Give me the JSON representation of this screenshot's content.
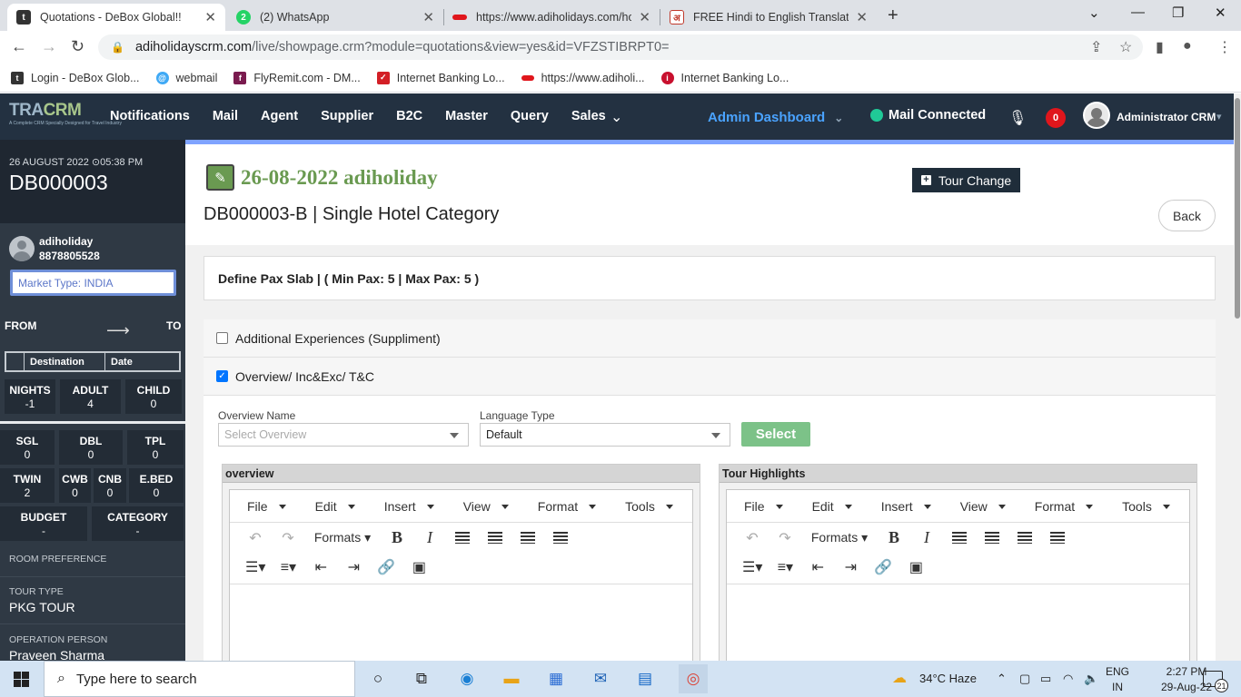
{
  "browser": {
    "tabs": [
      {
        "title": "Quotations - DeBox Global!!",
        "icon": "debox-favicon",
        "color": "#333333",
        "active": true
      },
      {
        "title": "(2) WhatsApp",
        "icon": "whatsapp-favicon",
        "color": "#25d366"
      },
      {
        "title": "https://www.adiholidays.com/hot",
        "icon": "adiholidays-favicon",
        "color": "#e0161c"
      },
      {
        "title": "FREE Hindi to English Translation",
        "icon": "translation-favicon",
        "color": "#c0392b"
      }
    ],
    "url_host": "adiholidayscrm.com",
    "url_path": "/live/showpage.crm?module=quotations&view=yes&id=VFZSTIBRPT0=",
    "bookmarks": [
      {
        "label": "Login - DeBox Glob...",
        "color": "#333333"
      },
      {
        "label": "webmail",
        "color": "#3fa9f5"
      },
      {
        "label": "FlyRemit.com - DM...",
        "color": "#7a1b4f"
      },
      {
        "label": "Internet Banking Lo...",
        "color": "#d31f26"
      },
      {
        "label": "https://www.adiholi...",
        "color": "#e0161c"
      },
      {
        "label": "Internet Banking Lo...",
        "color": "#c8102e"
      }
    ]
  },
  "header": {
    "logo_main": "TRA",
    "logo_crm": "CRM",
    "logo_tagline": "A Complete CRM Specially Designed for Travel Industry",
    "nav": [
      "Notifications",
      "Mail",
      "Agent",
      "Supplier",
      "B2C",
      "Master",
      "Query",
      "Sales"
    ],
    "admin_dashboard": "Admin Dashboard",
    "mail_status": "Mail Connected",
    "notification_count": "0",
    "user_name": "Administrator CRM"
  },
  "sidebar": {
    "date": "26 AUGUST 2022",
    "time": "05:38 PM",
    "query_id": "DB000003",
    "username": "adiholiday",
    "phone": "8878805528",
    "market_type": "Market Type: INDIA",
    "from_label": "FROM",
    "to_label": "TO",
    "table_headers": [
      "Destination",
      "Date"
    ],
    "stats1": [
      {
        "label": "NIGHTS",
        "value": "-1"
      },
      {
        "label": "ADULT",
        "value": "4"
      },
      {
        "label": "CHILD",
        "value": "0"
      }
    ],
    "stats2": [
      {
        "label": "SGL",
        "value": "0"
      },
      {
        "label": "DBL",
        "value": "0"
      },
      {
        "label": "TPL",
        "value": "0"
      }
    ],
    "stats3": [
      {
        "label": "TWIN",
        "value": "2"
      },
      {
        "label": "CWB",
        "value": "0"
      },
      {
        "label": "CNB",
        "value": "0"
      },
      {
        "label": "E.BED",
        "value": "0"
      }
    ],
    "stats4": [
      {
        "label": "BUDGET",
        "value": "-"
      },
      {
        "label": "CATEGORY",
        "value": "-"
      }
    ],
    "room_pref_label": "ROOM PREFERENCE",
    "tour_type_label": "TOUR TYPE",
    "tour_type": "PKG TOUR",
    "operation_label": "OPERATION PERSON",
    "operation_person": "Praveen Sharma"
  },
  "main": {
    "quote_date": "26-08-2022 adiholiday",
    "quote_name": "DB000003-B | Single Hotel Category",
    "tour_change": "Tour Change",
    "back": "Back",
    "pax_slab": "Define Pax Slab  | ( Min Pax: 5 | Max Pax: 5 )",
    "additional_exp": "Additional Experiences (Suppliment)",
    "additional_checked": false,
    "overview_section": "Overview/ Inc&Exc/ T&C",
    "overview_checked": true,
    "overview_name_label": "Overview Name",
    "overview_placeholder": "Select Overview",
    "language_label": "Language Type",
    "language_value": "Default",
    "select_btn": "Select",
    "editors": [
      {
        "title": "overview"
      },
      {
        "title": "Tour Highlights"
      }
    ],
    "editor_menu": [
      "File",
      "Edit",
      "Insert",
      "View",
      "Format",
      "Tools"
    ],
    "formats_label": "Formats"
  },
  "taskbar": {
    "search_placeholder": "Type here to search",
    "weather": "34°C  Haze",
    "lang_top": "ENG",
    "lang_bottom": "IN",
    "time": "2:27 PM",
    "date": "29-Aug-22",
    "notif_count": "21"
  }
}
